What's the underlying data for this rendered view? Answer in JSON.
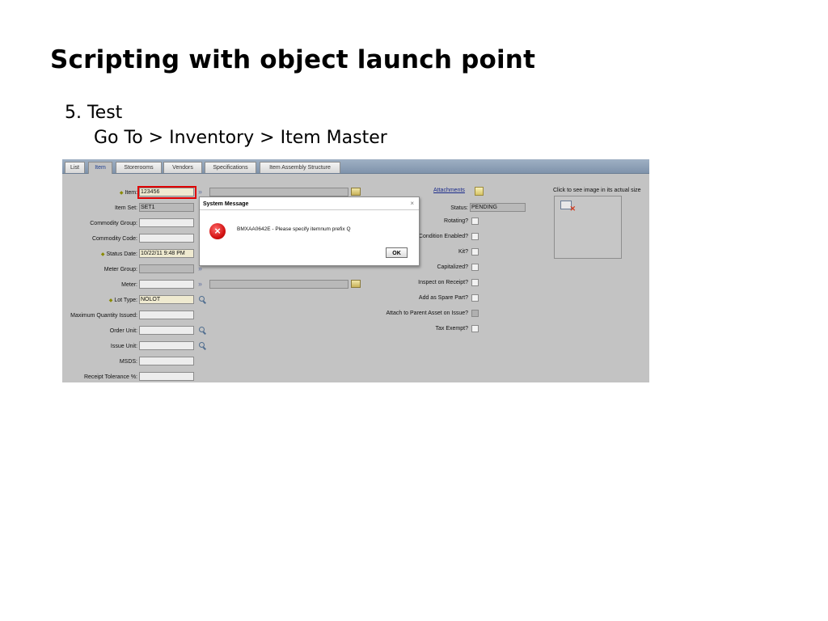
{
  "slide": {
    "title": "Scripting with object launch point",
    "step_line1": "5. Test",
    "step_line2": "Go To > Inventory > Item Master"
  },
  "tabs": [
    {
      "label": "List"
    },
    {
      "label": "Item",
      "active": true
    },
    {
      "label": "Storerooms"
    },
    {
      "label": "Vendors"
    },
    {
      "label": "Specifications"
    },
    {
      "label": "Item Assembly Structure"
    }
  ],
  "left_fields": {
    "item": {
      "label": "Item:",
      "value": "123456"
    },
    "item_set": {
      "label": "Item Set:",
      "value": "SET1"
    },
    "commodity_group": {
      "label": "Commodity Group:",
      "value": ""
    },
    "commodity_code": {
      "label": "Commodity Code:",
      "value": ""
    },
    "status_date": {
      "label": "Status Date:",
      "value": "10/22/11 9:48 PM"
    },
    "meter_group": {
      "label": "Meter Group:",
      "value": ""
    },
    "meter": {
      "label": "Meter:",
      "value": ""
    },
    "lot_type": {
      "label": "Lot Type:",
      "value": "NOLOT"
    },
    "max_qty_issued": {
      "label": "Maximum Quantity Issued:",
      "value": ""
    },
    "order_unit": {
      "label": "Order Unit:",
      "value": ""
    },
    "issue_unit": {
      "label": "Issue Unit:",
      "value": ""
    },
    "msds": {
      "label": "MSDS:",
      "value": ""
    },
    "receipt_tolerance": {
      "label": "Receipt Tolerance %:",
      "value": ""
    }
  },
  "right_fields": {
    "attachments": "Attachments",
    "status": {
      "label": "Status:",
      "value": "PENDING"
    },
    "rotating": "Rotating?",
    "condition_enabled": "Condition Enabled?",
    "kit": "Kit?",
    "capitalized": "Capitalized?",
    "inspect_on_receipt": "Inspect on Receipt?",
    "add_as_spare_part": "Add as Spare Part?",
    "attach_to_parent": "Attach to Parent Asset on Issue?",
    "tax_exempt": "Tax Exempt?"
  },
  "image_panel": {
    "note": "Click to see image in its actual size"
  },
  "dialog": {
    "title": "System Message",
    "close": "×",
    "message": "BMXAA0642E - Please specify itemnum prefix Q",
    "ok_label": "OK"
  },
  "icons": {
    "error": "error-icon",
    "lookup": "magnifier-icon",
    "detail": "double-chevron-icon",
    "select_value": "select-value-icon",
    "attachment": "paperclip-icon"
  },
  "colors": {
    "highlight_box": "#e00000",
    "form_background": "#c3c3c3",
    "error_red": "#d41414"
  }
}
